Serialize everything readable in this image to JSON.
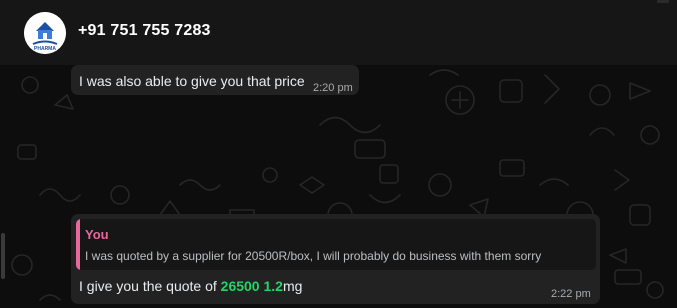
{
  "header": {
    "contact_name": "+91 751 755 7283",
    "avatar_text": "PHARMA"
  },
  "messages": [
    {
      "text": "I was also able to give you that price",
      "time": "2:20 pm"
    },
    {
      "quoted_author": "You",
      "quoted_text": "I was quoted by a supplier for 20500R/box, I will probably do business with them sorry",
      "text_prefix": "I give you the quote of ",
      "highlight_price": "26500",
      "highlight_dose": "1.2",
      "text_suffix": "mg",
      "time": "2:22 pm"
    }
  ],
  "colors": {
    "header_bg": "#161617",
    "chat_bg": "#0d0d0e",
    "bubble_bg": "#222223",
    "quote_accent": "#e8679c",
    "highlight": "#25d366"
  }
}
